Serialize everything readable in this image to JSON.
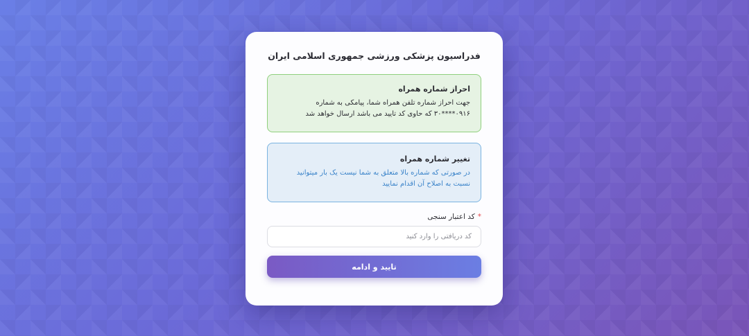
{
  "page": {
    "title": "فدراسیون پزشکی ورزشی جمهوری اسلامی ایران"
  },
  "alerts": {
    "verify": {
      "title": "احراز شماره همراه",
      "text": "جهت احراز شماره تلفن همراه شما، پیامکی به شماره ۰۹۱۶****۳۰ که حاوی کد تایید می باشد ارسال خواهد شد"
    },
    "change": {
      "title": "تغییر شماره همراه",
      "text": "در صورتی که شماره بالا متعلق به شما نیست یک بار میتوانید نسبت به اصلاح آن اقدام نمایید"
    }
  },
  "form": {
    "code_label": "کد اعتبار سنجی",
    "required_mark": "*",
    "code_value": "",
    "code_placeholder": "کد دریافتی را وارد کنید",
    "submit_label": "تایید و ادامه"
  },
  "colors": {
    "success_border": "#8fd07d",
    "success_bg": "#e6f3e3",
    "info_border": "#7ab3e0",
    "info_bg": "#e4eef8",
    "info_text": "#3a83c9",
    "required": "#e5484d",
    "button_gradient_start": "#6b7ee3",
    "button_gradient_end": "#7a5ac4"
  }
}
